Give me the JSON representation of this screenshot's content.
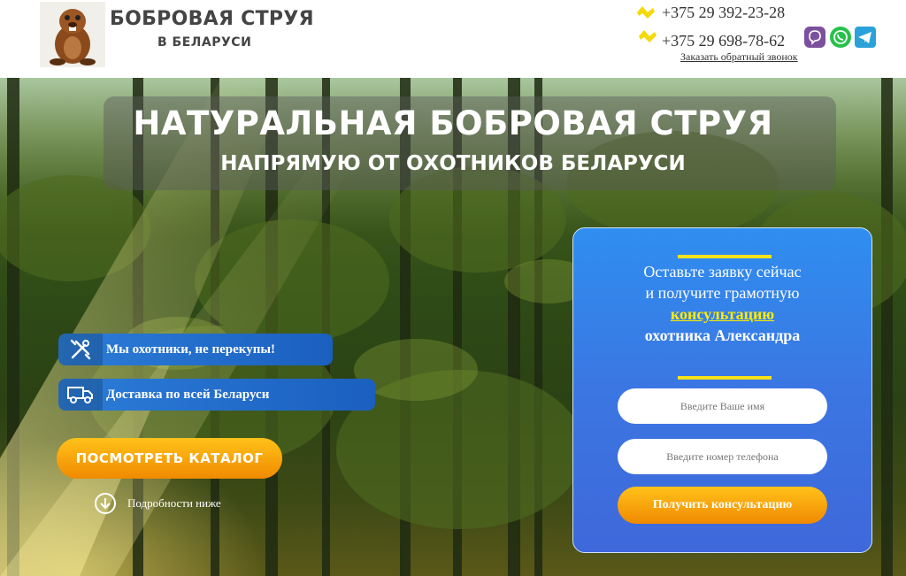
{
  "header": {
    "logo_title": "БОБРОВАЯ СТРУЯ",
    "logo_subtitle": "В БЕЛАРУСИ",
    "phones": [
      "+375 29 392-23-28",
      "+375 29 698-78-62"
    ],
    "callback_link": "Заказать обратный звонок",
    "messenger_icons": [
      "viber-icon",
      "whatsapp-icon",
      "telegram-icon"
    ]
  },
  "hero": {
    "title": "НАТУРАЛЬНАЯ БОБРОВАЯ СТРУЯ",
    "subtitle": "НАПРЯМУЮ ОТ ОХОТНИКОВ БЕЛАРУСИ",
    "features": [
      {
        "icon": "tools-icon",
        "label": "Мы охотники, не перекупы!"
      },
      {
        "icon": "truck-icon",
        "label": "Доставка по всей Беларуси"
      }
    ],
    "catalog_button": "ПОСМОТРЕТЬ КАТАЛОГ",
    "details_link": "Подробности ниже"
  },
  "form": {
    "line1": "Оставьте заявку сейчас",
    "line2": "и получите грамотную",
    "highlight": "консультацию",
    "line4": "охотника Александра",
    "name_placeholder": "Введите Ваше имя",
    "phone_placeholder": "Введите номер телефона",
    "submit_label": "Получить консультацию"
  },
  "colors": {
    "accent_yellow": "#ffec00",
    "button_orange": "#f5a000",
    "form_blue": "#3b76e2"
  }
}
